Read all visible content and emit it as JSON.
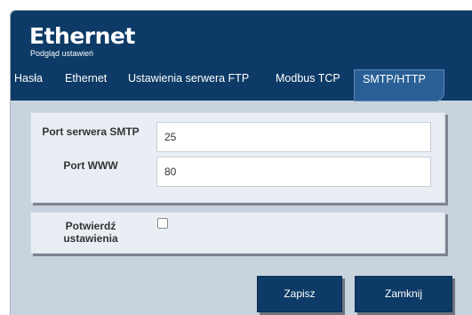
{
  "window": {
    "title": "Ethernet",
    "subtitle": "Podgląd ustawień"
  },
  "tabs": [
    {
      "label": "Hasła",
      "active": false
    },
    {
      "label": "Ethernet",
      "active": false
    },
    {
      "label": "Ustawienia serwera FTP",
      "active": false
    },
    {
      "label": "Modbus TCP",
      "active": false
    },
    {
      "label": "SMTP/HTTP",
      "active": true
    }
  ],
  "form": {
    "smtp_port_label": "Port serwera SMTP",
    "smtp_port_value": "25",
    "www_port_label": "Port WWW",
    "www_port_value": "80",
    "confirm_label": "Potwierdź ustawienia",
    "confirm_checked": false
  },
  "buttons": {
    "save_label": "Zapisz",
    "close_label": "Zamknij"
  },
  "colors": {
    "header": "#0d3a66",
    "active_tab": "#2a5f95",
    "panel": "#e8eef4",
    "background": "#c9d3de"
  }
}
